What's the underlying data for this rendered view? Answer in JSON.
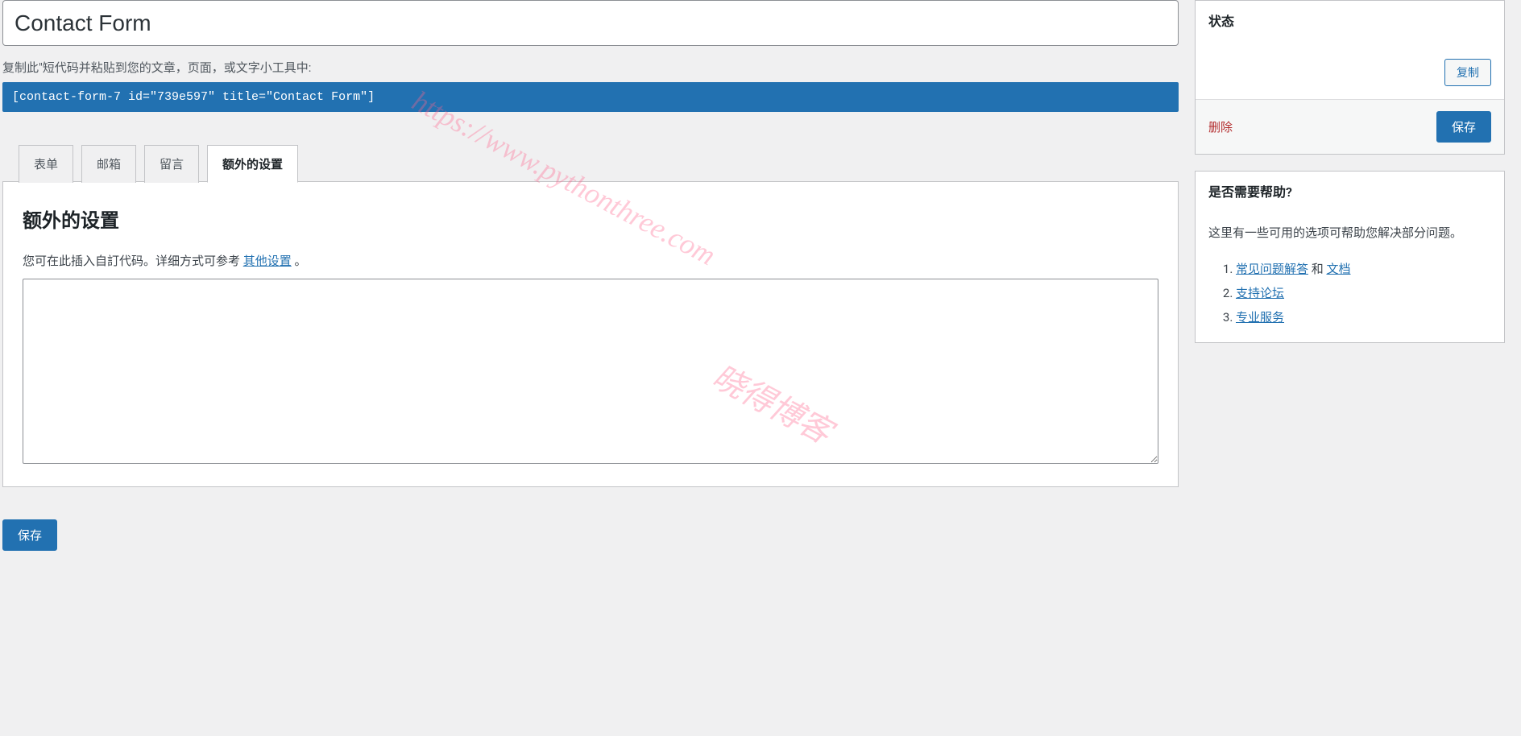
{
  "form": {
    "title": "Contact Form",
    "shortcode_label": "复制此\"短代码并粘贴到您的文章，页面，或文字小工具中:",
    "shortcode": "[contact-form-7 id=\"739e597\" title=\"Contact Form\"]"
  },
  "tabs": {
    "form": "表单",
    "mail": "邮箱",
    "messages": "留言",
    "additional": "额外的设置"
  },
  "panel": {
    "heading": "额外的设置",
    "description_prefix": "您可在此插入自訂代码。详细方式可参考 ",
    "description_link": "其他设置",
    "description_suffix": " 。",
    "textarea_value": ""
  },
  "buttons": {
    "save": "保存",
    "copy": "复制",
    "delete": "删除"
  },
  "status_box": {
    "title": "状态"
  },
  "help_box": {
    "title": "是否需要帮助?",
    "intro": "这里有一些可用的选项可帮助您解决部分问题。",
    "item1_link": "常见问题解答",
    "item1_and": " 和 ",
    "item1_link2": "文档",
    "item2": "支持论坛",
    "item3": "专业服务"
  },
  "watermarks": {
    "url": "https://www.pythonthree.com",
    "blog": "晓得博客"
  }
}
